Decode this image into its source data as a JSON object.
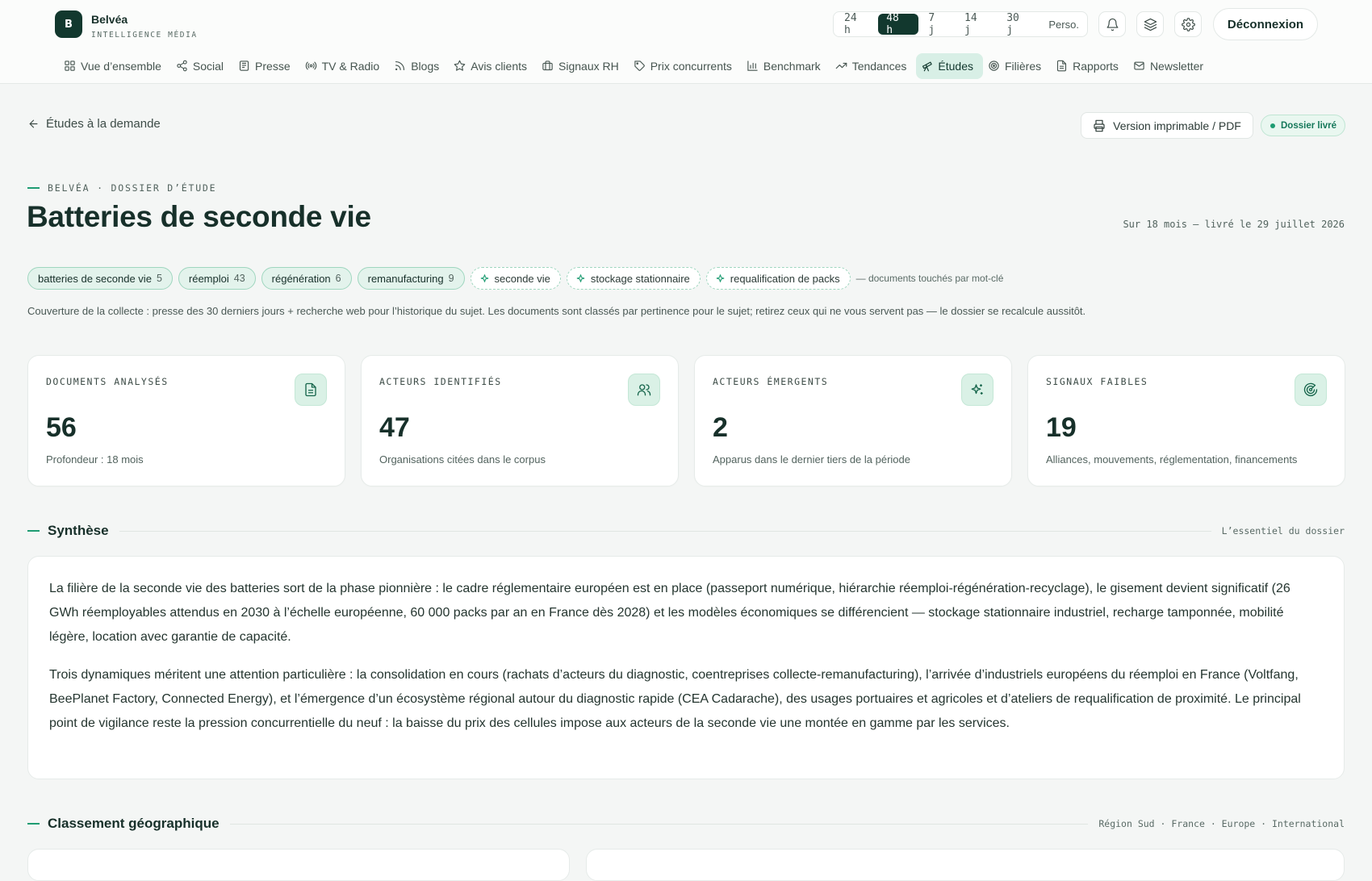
{
  "brand": {
    "initial": "B",
    "name": "Belvéa",
    "tagline": "INTELLIGENCE MÉDIA"
  },
  "time_range": {
    "options": [
      "24 h",
      "48 h",
      "7 j",
      "14 j",
      "30 j",
      "Perso."
    ],
    "selected": "48 h"
  },
  "header_icons": [
    "bell-icon",
    "layers-icon",
    "gear-icon"
  ],
  "logout_label": "Déconnexion",
  "nav": {
    "items": [
      {
        "label": "Vue d’ensemble",
        "icon": "grid-icon"
      },
      {
        "label": "Social",
        "icon": "share-icon"
      },
      {
        "label": "Presse",
        "icon": "newspaper-icon"
      },
      {
        "label": "TV & Radio",
        "icon": "broadcast-icon"
      },
      {
        "label": "Blogs",
        "icon": "rss-icon"
      },
      {
        "label": "Avis clients",
        "icon": "star-icon"
      },
      {
        "label": "Signaux RH",
        "icon": "briefcase-icon"
      },
      {
        "label": "Prix concurrents",
        "icon": "tag-icon"
      },
      {
        "label": "Benchmark",
        "icon": "bar-chart-icon"
      },
      {
        "label": "Tendances",
        "icon": "trending-up-icon"
      },
      {
        "label": "Études",
        "icon": "telescope-icon",
        "active": true
      },
      {
        "label": "Filières",
        "icon": "target-icon"
      },
      {
        "label": "Rapports",
        "icon": "file-icon"
      },
      {
        "label": "Newsletter",
        "icon": "mail-icon"
      }
    ]
  },
  "back_label": "Études à la demande",
  "print_label": "Version imprimable / PDF",
  "status": {
    "label": "Dossier livré",
    "color": "#1e9c72"
  },
  "eyebrow": "BELVÉA · DOSSIER D’ÉTUDE",
  "title": "Batteries de seconde vie",
  "period": "Sur 18 mois — livré le 29 juillet 2026",
  "keywords": [
    {
      "label": "batteries de seconde vie",
      "count": "5"
    },
    {
      "label": "réemploi",
      "count": "43"
    },
    {
      "label": "régénération",
      "count": "6"
    },
    {
      "label": "remanufacturing",
      "count": "9"
    }
  ],
  "suggested_keywords": [
    "seconde vie",
    "stockage stationnaire",
    "requalification de packs"
  ],
  "keywords_note": "— documents touchés par mot-clé",
  "coverage": "Couverture de la collecte : presse des 30 derniers jours + recherche web pour l’historique du sujet. Les documents sont classés par pertinence pour le sujet; retirez ceux qui ne vous servent pas — le dossier se recalcule aussitôt.",
  "stats": [
    {
      "label": "DOCUMENTS ANALYSÉS",
      "value": "56",
      "desc": "Profondeur : 18 mois",
      "icon": "document-icon"
    },
    {
      "label": "ACTEURS IDENTIFIÉS",
      "value": "47",
      "desc": "Organisations citées dans le corpus",
      "icon": "users-icon"
    },
    {
      "label": "ACTEURS ÉMERGENTS",
      "value": "2",
      "desc": "Apparus dans le dernier tiers de la période",
      "icon": "sparkles-icon"
    },
    {
      "label": "SIGNAUX FAIBLES",
      "value": "19",
      "desc": "Alliances, mouvements, réglementation, financements",
      "icon": "radar-icon"
    }
  ],
  "synthesis": {
    "title": "Synthèse",
    "meta": "L’essentiel du dossier",
    "paragraphs": [
      "La filière de la seconde vie des batteries sort de la phase pionnière : le cadre réglementaire européen est en place (passeport numérique, hiérarchie réemploi-régénération-recyclage), le gisement devient significatif (26 GWh réemployables attendus en 2030 à l’échelle européenne, 60 000 packs par an en France dès 2028) et les modèles économiques se différencient — stockage stationnaire industriel, recharge tamponnée, mobilité légère, location avec garantie de capacité.",
      "Trois dynamiques méritent une attention particulière : la consolidation en cours (rachats d’acteurs du diagnostic, coentreprises collecte-remanufacturing), l’arrivée d’industriels européens du réemploi en France (Voltfang, BeePlanet Factory, Connected Energy), et l’émergence d’un écosystème régional autour du diagnostic rapide (CEA Cadarache), des usages portuaires et agricoles et d’ateliers de requalification de proximité. Le principal point de vigilance reste la pression concurrentielle du neuf : la baisse du prix des cellules impose aux acteurs de la seconde vie une montée en gamme par les services."
    ]
  },
  "geo": {
    "title": "Classement géographique",
    "meta": "Région Sud · France · Europe · International"
  }
}
